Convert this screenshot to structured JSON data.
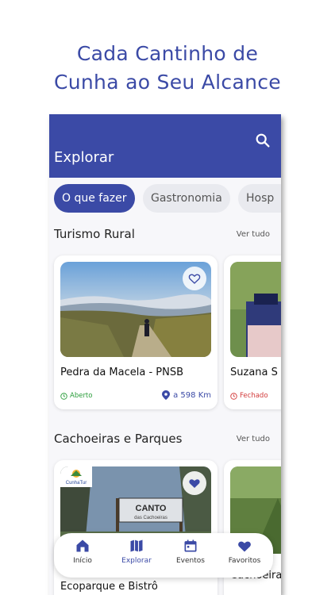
{
  "headline": {
    "line1": "Cada Cantinho de",
    "line2": "Cunha ao Seu Alcance"
  },
  "appbar": {
    "title": "Explorar",
    "search_icon": "search-icon"
  },
  "chips": [
    {
      "label": "O que fazer",
      "active": true
    },
    {
      "label": "Gastronomia",
      "active": false
    },
    {
      "label": "Hosp",
      "active": false
    }
  ],
  "sections": [
    {
      "title": "Turismo Rural",
      "see_all": "Ver tudo",
      "cards": [
        {
          "title": "Pedra da Macela - PNSB",
          "status": "Aberto",
          "distance": "a 598 Km",
          "favorite": false
        },
        {
          "title": "Suzana S",
          "status": "Fechado",
          "distance": "",
          "favorite": false
        }
      ]
    },
    {
      "title": "Cachoeiras e Parques",
      "see_all": "Ver tudo",
      "cards": [
        {
          "title": "Ecoparque e Bistrô",
          "sign_text": "CANTO",
          "sign_subtext": "das Cachoeiras",
          "logo_text": "CunhaTur",
          "favorite": true
        },
        {
          "title": "Cachoeira",
          "favorite": false
        }
      ]
    }
  ],
  "bottom_nav": [
    {
      "label": "Início",
      "icon": "home-icon",
      "active": false
    },
    {
      "label": "Explorar",
      "icon": "map-icon",
      "active": true
    },
    {
      "label": "Eventos",
      "icon": "calendar-icon",
      "active": false
    },
    {
      "label": "Favoritos",
      "icon": "heart-icon",
      "active": false
    }
  ],
  "colors": {
    "primary": "#3b4aa6",
    "open": "#2a9d3b",
    "closed": "#d23a3a"
  }
}
